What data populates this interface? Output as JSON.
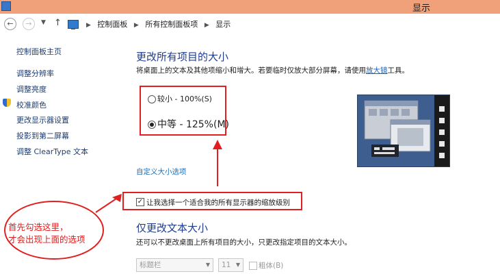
{
  "window": {
    "title": "显示"
  },
  "breadcrumbs": [
    "控制面板",
    "所有控制面板项",
    "显示"
  ],
  "sidebar": {
    "home": "控制面板主页",
    "items": [
      "调整分辨率",
      "调整亮度",
      "校准颜色",
      "更改显示器设置",
      "投影到第二屏幕",
      "调整 ClearType 文本"
    ]
  },
  "main": {
    "title": "更改所有项目的大小",
    "desc_prefix": "将桌面上的文本及其他项缩小和增大。若要临时仅放大部分屏幕，请使用",
    "desc_link": "放大镜",
    "desc_suffix": "工具。",
    "options": [
      {
        "label": "较小 - 100%(S)",
        "checked": false
      },
      {
        "label": "中等 - 125%(M)",
        "checked": true
      }
    ],
    "custom_link": "自定义大小选项",
    "checkbox_label": "让我选择一个适合我的所有显示器的缩放级别",
    "checkbox_checked": true
  },
  "section2": {
    "title": "仅更改文本大小",
    "desc": "还可以不更改桌面上所有项目的大小，只更改指定项目的文本大小。",
    "item_select": "标题栏",
    "size_select": "11",
    "bold_label": "粗体(B)"
  },
  "annotation": {
    "line1": "首先勾选这里，",
    "line2": "才会出现上面的选项",
    "color": "#e02020"
  },
  "colors": {
    "titlebar": "#f0a17a",
    "heading": "#1e3c8e",
    "link": "#1a5fb4"
  }
}
